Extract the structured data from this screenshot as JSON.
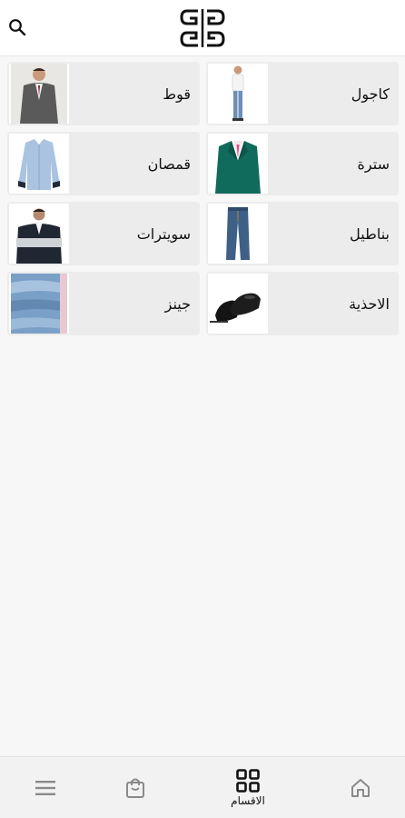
{
  "header": {
    "search_icon": "search-icon",
    "logo_text": "GG"
  },
  "categories": [
    {
      "label": "كاجول",
      "image": "casual-man-photo"
    },
    {
      "label": "قوط",
      "image": "suit-man-photo"
    },
    {
      "label": "سترة",
      "image": "green-blazer-photo"
    },
    {
      "label": "قمصان",
      "image": "blue-shirt-photo"
    },
    {
      "label": "بناطيل",
      "image": "jeans-pants-photo"
    },
    {
      "label": "سويترات",
      "image": "sweater-photo"
    },
    {
      "label": "الاحذية",
      "image": "black-shoes-photo"
    },
    {
      "label": "جينز",
      "image": "folded-jeans-photo"
    }
  ],
  "bottom_nav": {
    "items": [
      {
        "icon": "home-icon",
        "label": ""
      },
      {
        "icon": "grid-icon",
        "label": "الاقسام",
        "active": true
      },
      {
        "icon": "shopping-bag-icon",
        "label": ""
      },
      {
        "icon": "menu-icon",
        "label": ""
      }
    ]
  },
  "colors": {
    "background": "#f7f7f7",
    "card": "#ececec",
    "header": "#ffffff",
    "nav": "#f2f2f2",
    "text": "#111111",
    "inactive_icon": "#8a8a8a"
  }
}
